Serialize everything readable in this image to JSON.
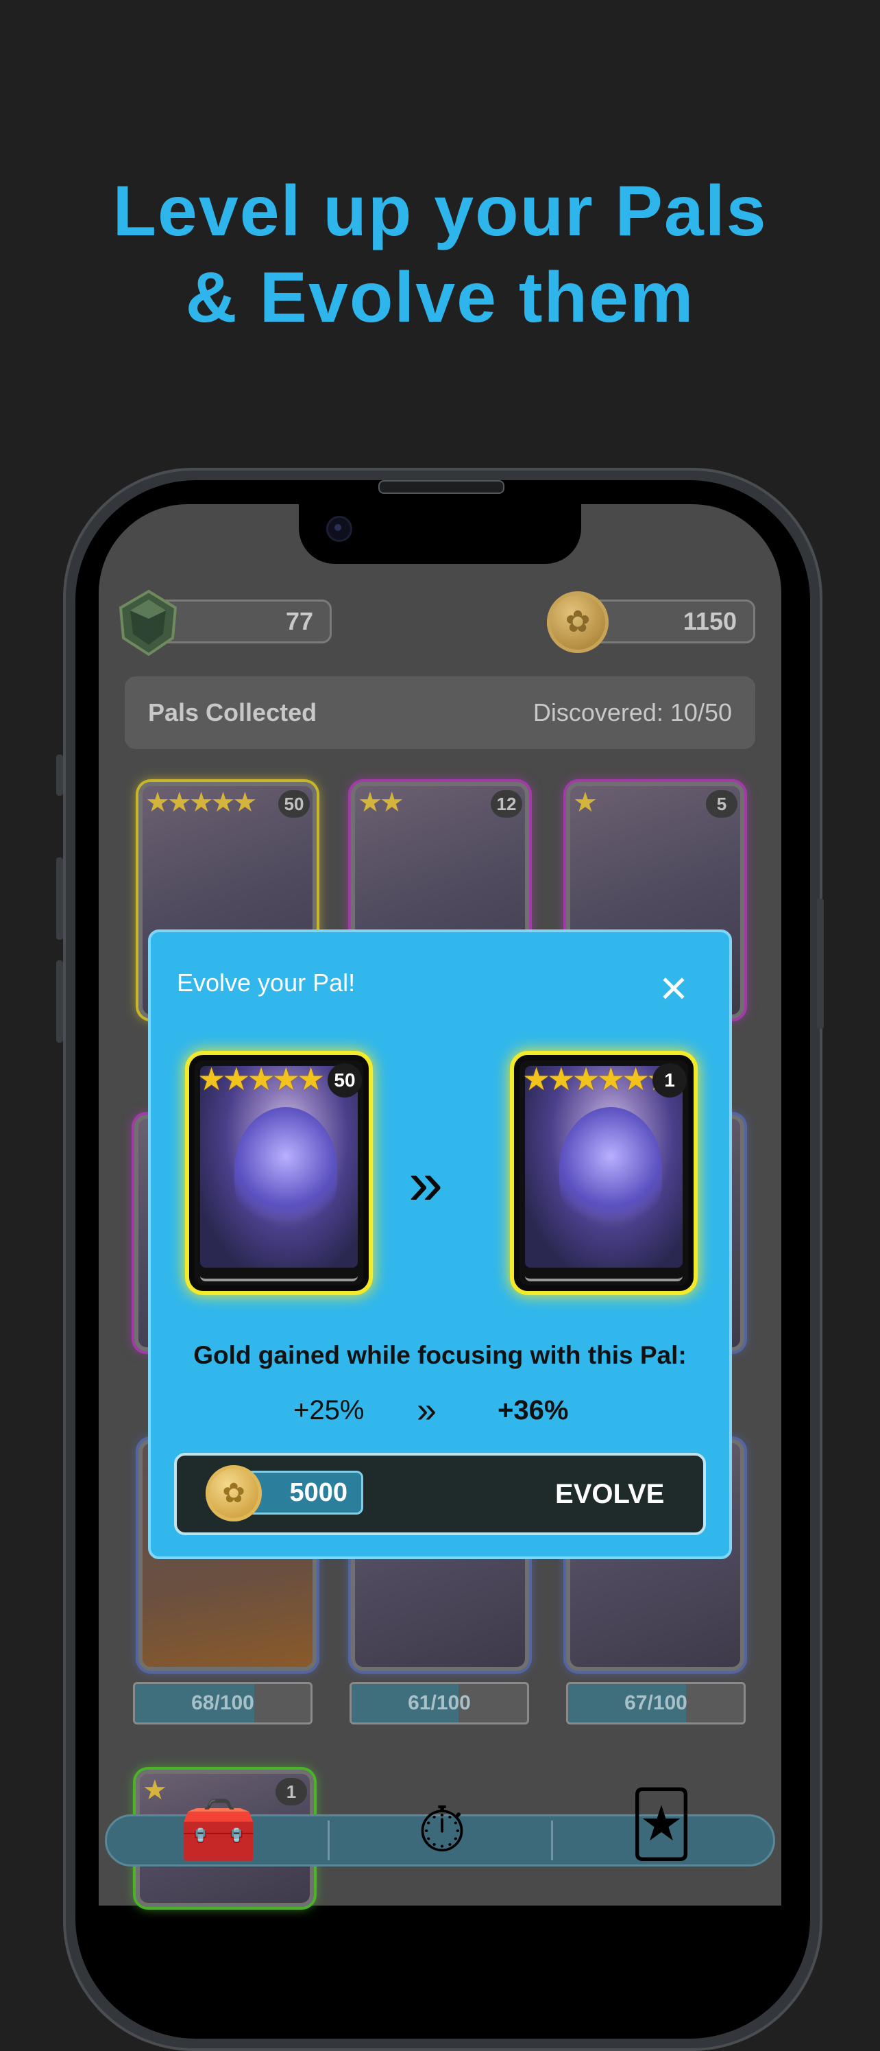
{
  "headline": {
    "line1": "Level up your Pals",
    "line2": "& Evolve them"
  },
  "currency": {
    "gems": "77",
    "gold": "1150"
  },
  "collection": {
    "title": "Pals Collected",
    "discovered": "Discovered: 10/50"
  },
  "cards": [
    {
      "level": "50",
      "stars": "★★★★★",
      "rarity": "yellow"
    },
    {
      "level": "12",
      "stars": "★★",
      "rarity": "purple"
    },
    {
      "level": "5",
      "stars": "★",
      "rarity": "purple"
    },
    {
      "level": "1",
      "stars": "★",
      "rarity": "green"
    }
  ],
  "xp_bars": [
    {
      "label": "68/100",
      "fraction": 0.68
    },
    {
      "label": "61/100",
      "fraction": 0.61
    },
    {
      "label": "67/100",
      "fraction": 0.67
    }
  ],
  "modal": {
    "title": "Evolve your Pal!",
    "close_icon": "×",
    "from_card": {
      "stars": "★★★★★",
      "level": "50"
    },
    "to_card": {
      "stars": "★★★★★★",
      "level": "1"
    },
    "arrow_icon": "»",
    "gold_line": "Gold gained while focusing with this Pal:",
    "bonus_old": "+25%",
    "bonus_arrow": "»",
    "bonus_new": "+36%",
    "cost": "5000",
    "evolve_label": "EVOLVE"
  },
  "nav": {
    "items": [
      {
        "icon": "treasure-chest-icon",
        "glyph": "🧰"
      },
      {
        "icon": "focus-timer-icon",
        "glyph": "⏱"
      },
      {
        "icon": "cards-collection-icon",
        "glyph": "🃏"
      }
    ]
  },
  "colors": {
    "accent": "#2eb6ec",
    "modal_bg": "#31b7ec",
    "card_glow": "#f2ea2a"
  }
}
